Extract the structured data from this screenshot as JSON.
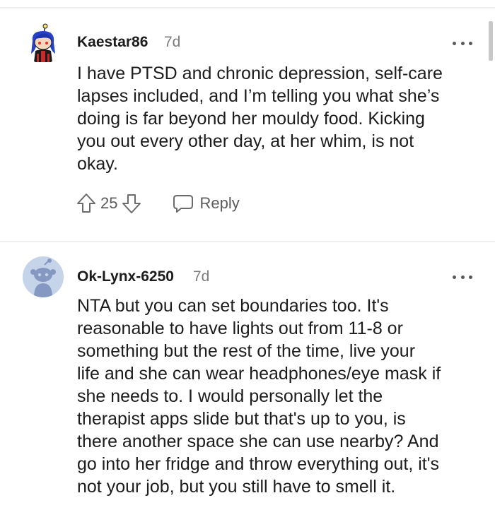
{
  "comments": [
    {
      "username": "Kaestar86",
      "time": "7d",
      "body": "I have PTSD and chronic depression, self-care\nlapses included, and I’m telling you what she’s\ndoing is far beyond her mouldy food. Kicking\nyou out every other day, at her whim, is not\nokay.",
      "votes": "25",
      "reply_label": "Reply",
      "avatar": "snoo-avatar-blue-hair"
    },
    {
      "username": "Ok-Lynx-6250",
      "time": "7d",
      "body": "NTA but you can set boundaries too. It's\nreasonable to have lights out from 11-8 or\nsomething but the rest of the time, live your\nlife and she can wear headphones/eye mask if\nshe needs to. I would personally let the\ntherapist apps slide but that's up to you, is\nthere another space she can use nearby? And\ngo into her fridge and throw everything out, it's\nnot your job, but you still have to smell it.",
      "avatar": "default-snoo-avatar"
    }
  ],
  "icons": {
    "upvote": "upvote-arrow-icon",
    "downvote": "downvote-arrow-icon",
    "reply": "speech-bubble-icon",
    "more": "more-options-icon"
  },
  "colors": {
    "username": "#1c1c1c",
    "meta": "#7c7c7c",
    "divider": "#edeff1",
    "default_avatar_bg": "#c6d4ea"
  }
}
